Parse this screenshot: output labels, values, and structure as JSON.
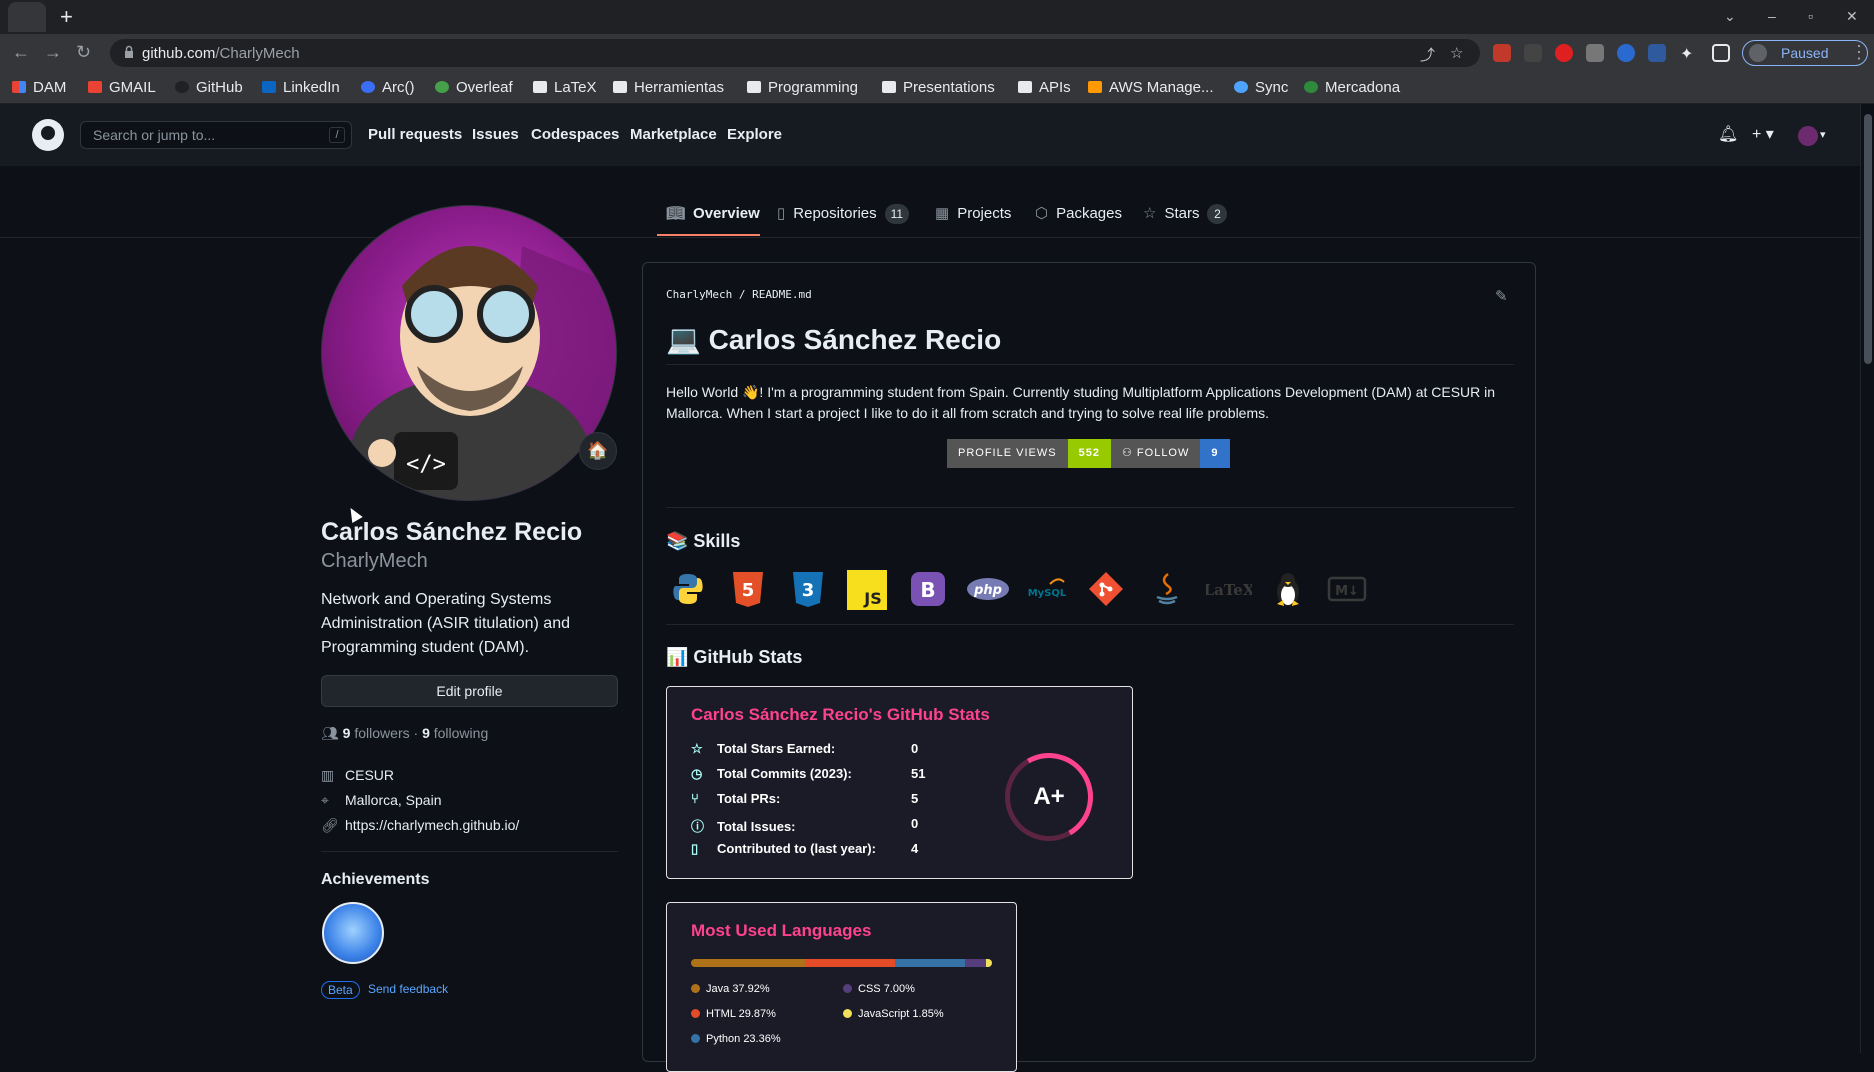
{
  "browser": {
    "url_host": "github.com",
    "url_path": "/CharlyMech",
    "new_tab_icon": "plus-icon",
    "profile_status": "Paused",
    "bookmarks": [
      {
        "label": "DAM",
        "icon": "app-grid-icon"
      },
      {
        "label": "GMAIL",
        "icon": "gmail-icon"
      },
      {
        "label": "GitHub",
        "icon": "github-icon"
      },
      {
        "label": "LinkedIn",
        "icon": "linkedin-icon"
      },
      {
        "label": "Arc()",
        "icon": "arc-icon"
      },
      {
        "label": "Overleaf",
        "icon": "overleaf-icon"
      },
      {
        "label": "LaTeX",
        "icon": "folder-icon"
      },
      {
        "label": "Herramientas",
        "icon": "folder-icon"
      },
      {
        "label": "Programming",
        "icon": "folder-icon"
      },
      {
        "label": "Presentations",
        "icon": "folder-icon"
      },
      {
        "label": "APIs",
        "icon": "folder-icon"
      },
      {
        "label": "AWS Manage...",
        "icon": "aws-icon"
      },
      {
        "label": "Sync",
        "icon": "sync-icon"
      },
      {
        "label": "Mercadona",
        "icon": "mercadona-icon"
      }
    ]
  },
  "github": {
    "search_placeholder": "Search or jump to...",
    "search_shortcut": "/",
    "nav": [
      "Pull requests",
      "Issues",
      "Codespaces",
      "Marketplace",
      "Explore"
    ]
  },
  "profile_tabs": [
    {
      "label": "Overview",
      "count": null,
      "active": true,
      "icon": "book-icon"
    },
    {
      "label": "Repositories",
      "count": "11",
      "icon": "repo-icon"
    },
    {
      "label": "Projects",
      "count": null,
      "icon": "table-icon"
    },
    {
      "label": "Packages",
      "count": null,
      "icon": "package-icon"
    },
    {
      "label": "Stars",
      "count": "2",
      "icon": "star-icon"
    }
  ],
  "sidebar": {
    "status_emoji": "🏠",
    "full_name": "Carlos Sánchez Recio",
    "login": "CharlyMech",
    "bio": "Network and Operating Systems Administration (ASIR titulation) and Programming student (DAM).",
    "edit_button": "Edit profile",
    "followers_count": "9",
    "followers_label": "followers",
    "separator": "·",
    "following_count": "9",
    "following_label": "following",
    "company": "CESUR",
    "location": "Mallorca, Spain",
    "website": "https://charlymech.github.io/",
    "achievements_title": "Achievements",
    "beta_label": "Beta",
    "feedback_label": "Send feedback"
  },
  "readme": {
    "path_user": "CharlyMech",
    "path_sep": "/",
    "path_file": "README.md",
    "title": "💻 Carlos Sánchez Recio",
    "intro": "Hello World 👋! I'm a programming student from Spain. Currently studing Multiplatform Applications Development (DAM) at CESUR in Mallorca. When I start a project I like to do it all from scratch and trying to solve real life problems.",
    "views_badge": {
      "label": "PROFILE VIEWS",
      "value": "552",
      "color": "#97ca00"
    },
    "follow_badge": {
      "label": "FOLLOW",
      "value": "9",
      "color": "#3173c9"
    },
    "skills_title": "📚 Skills",
    "skills": [
      "python-icon",
      "html5-icon",
      "css3-icon",
      "javascript-icon",
      "bootstrap-icon",
      "php-icon",
      "mysql-icon",
      "git-icon",
      "java-icon",
      "latex-icon",
      "linux-icon",
      "markdown-icon"
    ],
    "stats_title": "📊 GitHub Stats"
  },
  "stats_card": {
    "title": "Carlos Sánchez Recio's GitHub Stats",
    "rows": [
      {
        "label": "Total Stars Earned:",
        "value": "0",
        "icon": "star-icon"
      },
      {
        "label": "Total Commits (2023):",
        "value": "51",
        "icon": "history-icon"
      },
      {
        "label": "Total PRs:",
        "value": "5",
        "icon": "pull-request-icon"
      },
      {
        "label": "Total Issues:",
        "value": "0",
        "icon": "issue-icon"
      },
      {
        "label": "Contributed to (last year):",
        "value": "4",
        "icon": "repo-icon"
      }
    ],
    "rank": "A+",
    "title_color": "#fe428e"
  },
  "lang_card": {
    "title": "Most Used Languages",
    "languages": [
      {
        "name": "Java",
        "percent": "37.92%",
        "value": 37.92,
        "color": "#b07219"
      },
      {
        "name": "HTML",
        "percent": "29.87%",
        "value": 29.87,
        "color": "#e34c26"
      },
      {
        "name": "Python",
        "percent": "23.36%",
        "value": 23.36,
        "color": "#3572a5"
      },
      {
        "name": "CSS",
        "percent": "7.00%",
        "value": 7.0,
        "color": "#563d7c"
      },
      {
        "name": "JavaScript",
        "percent": "1.85%",
        "value": 1.85,
        "color": "#f1e05a"
      }
    ]
  }
}
